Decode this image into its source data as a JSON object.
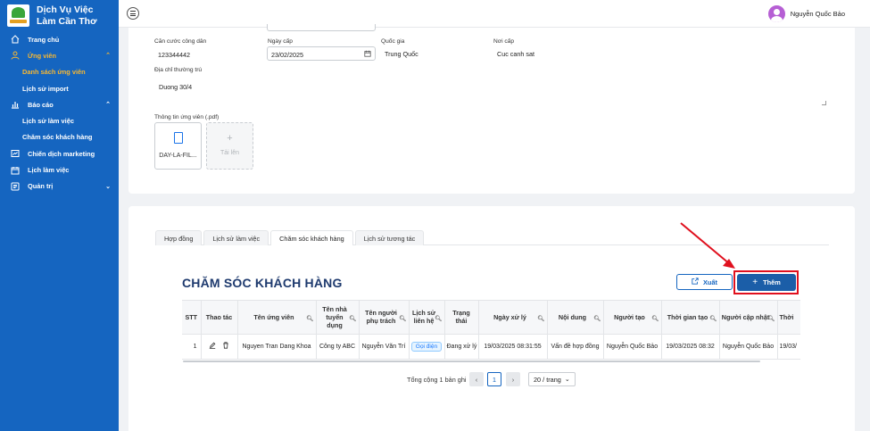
{
  "app": {
    "title": "Dịch Vụ Việc Làm Cần Thơ",
    "user_name": "Nguyễn Quốc Bảo"
  },
  "sidebar": {
    "items": [
      {
        "label": "Trang chủ",
        "icon": "home-icon"
      },
      {
        "label": "Ứng viên",
        "icon": "user-icon",
        "expanded": true
      },
      {
        "label": "Danh sách ứng viên",
        "sub": true,
        "active": true
      },
      {
        "label": "Lịch sử import",
        "sub": true
      },
      {
        "label": "Báo cáo",
        "icon": "chart-icon",
        "expanded": true
      },
      {
        "label": "Lịch sử làm việc",
        "sub": true
      },
      {
        "label": "Chăm sóc khách hàng",
        "sub": true
      },
      {
        "label": "Chiến dịch marketing",
        "icon": "campaign-icon"
      },
      {
        "label": "Lịch làm việc",
        "icon": "calendar-icon"
      },
      {
        "label": "Quản trị",
        "icon": "admin-icon",
        "expanded": false
      }
    ]
  },
  "form": {
    "cccd_label": "Căn cước công dân",
    "cccd_value": "123344442",
    "issue_date_label": "Ngày cấp",
    "issue_date_value": "23/02/2025",
    "country_label": "Quốc gia",
    "country_value": "Trung Quốc",
    "issue_place_label": "Nơi cấp",
    "issue_place_value": "Cuc canh sat",
    "address_label": "Địa chỉ thường trú",
    "address_value": "Duong 30/4",
    "attachment_label": "Thông tin ứng viên (.pdf)",
    "file_name": "DAY-LA-FIL...",
    "upload_label": "Tải lên"
  },
  "tabs": [
    {
      "label": "Hợp đồng"
    },
    {
      "label": "Lịch sử làm việc"
    },
    {
      "label": "Chăm sóc khách hàng",
      "active": true
    },
    {
      "label": "Lịch sử tương tác"
    }
  ],
  "section": {
    "title": "CHĂM SÓC KHÁCH HÀNG",
    "export_label": "Xuất",
    "add_label": "Thêm"
  },
  "table": {
    "columns": [
      {
        "label": "STT"
      },
      {
        "label": "Thao tác"
      },
      {
        "label": "Tên ứng viên",
        "search": true
      },
      {
        "label": "Tên nhà tuyển dụng",
        "search": true
      },
      {
        "label": "Tên người phụ trách",
        "search": true
      },
      {
        "label": "Lịch sử liên hệ",
        "search": true
      },
      {
        "label": "Trạng thái"
      },
      {
        "label": "Ngày xử lý",
        "search": true
      },
      {
        "label": "Nội dung",
        "search": true
      },
      {
        "label": "Người tạo",
        "search": true
      },
      {
        "label": "Thời gian tạo",
        "search": true
      },
      {
        "label": "Người cập nhật",
        "search": true
      },
      {
        "label": "Thời"
      }
    ],
    "rows": [
      {
        "stt": "1",
        "candidate": "Nguyen Tran Dang Khoa",
        "employer": "Công ty ABC",
        "owner": "Nguyễn Văn Trí",
        "contact": "Gọi điện",
        "status": "Đang xử lý",
        "processed_date": "19/03/2025 08:31:55",
        "content": "Vấn đề hợp đồng",
        "creator": "Nguyễn Quốc Bảo",
        "created_time": "19/03/2025 08:32",
        "updater": "Nguyễn Quốc Bảo",
        "last": "19/03/"
      }
    ]
  },
  "pagination": {
    "total": "Tổng cộng 1 bản ghi",
    "current": "1",
    "page_size": "20 / trang"
  },
  "colors": {
    "sidebar": "#1565c0",
    "active_nav": "#f7b731",
    "title": "#1e3a6e",
    "annotation": "#e0101e"
  }
}
